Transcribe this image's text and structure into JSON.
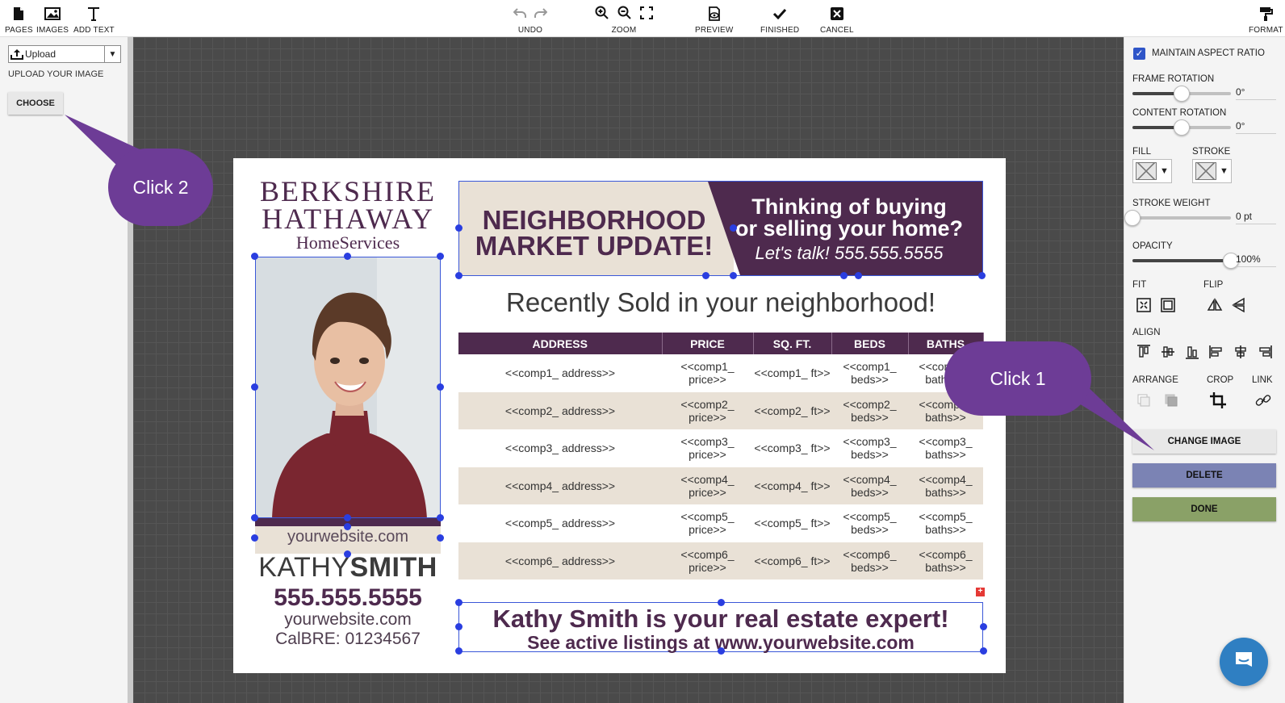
{
  "toolbar": {
    "pages": "PAGES",
    "images": "IMAGES",
    "add_text": "ADD TEXT",
    "undo": "UNDO",
    "zoom": "ZOOM",
    "preview": "PREVIEW",
    "finished": "FINISHED",
    "cancel": "CANCEL",
    "format": "FORMAT"
  },
  "left_panel": {
    "upload_select": "Upload",
    "upload_label": "UPLOAD YOUR IMAGE",
    "choose_button": "CHOOSE"
  },
  "card": {
    "logo_line1": "BERKSHIRE",
    "logo_line2": "HATHAWAY",
    "logo_line3": "HomeServices",
    "header_left": "NEIGHBORHOOD MARKET UPDATE!",
    "header_right_line1": "Thinking of buying",
    "header_right_line2": "or selling your home?",
    "header_right_line3": "Let's talk! 555.555.5555",
    "sold_title": "Recently Sold in your neighborhood!",
    "table": {
      "headers": [
        "ADDRESS",
        "PRICE",
        "SQ. FT.",
        "BEDS",
        "BATHS"
      ],
      "rows": [
        [
          "<<comp1_ address>>",
          "<<comp1_ price>>",
          "<<comp1_ ft>>",
          "<<comp1_ beds>>",
          "<<comp1_ baths>>"
        ],
        [
          "<<comp2_ address>>",
          "<<comp2_ price>>",
          "<<comp2_ ft>>",
          "<<comp2_ beds>>",
          "<<comp2_ baths>>"
        ],
        [
          "<<comp3_ address>>",
          "<<comp3_ price>>",
          "<<comp3_ ft>>",
          "<<comp3_ beds>>",
          "<<comp3_ baths>>"
        ],
        [
          "<<comp4_ address>>",
          "<<comp4_ price>>",
          "<<comp4_ ft>>",
          "<<comp4_ beds>>",
          "<<comp4_ baths>>"
        ],
        [
          "<<comp5_ address>>",
          "<<comp5_ price>>",
          "<<comp5_ ft>>",
          "<<comp5_ beds>>",
          "<<comp5_ baths>>"
        ],
        [
          "<<comp6_ address>>",
          "<<comp6_ price>>",
          "<<comp6_ ft>>",
          "<<comp6_ beds>>",
          "<<comp6_ baths>>"
        ]
      ]
    },
    "website_band": "yourwebsite.com",
    "agent_first": "KATHY",
    "agent_last": "SMITH",
    "agent_phone": "555.555.5555",
    "agent_website": "yourwebsite.com",
    "agent_license": "CalBRE: 01234567",
    "bottom_line1": "Kathy Smith is your real estate expert!",
    "bottom_line2": "See active listings at www.yourwebsite.com"
  },
  "right_panel": {
    "maintain_aspect": "MAINTAIN ASPECT RATIO",
    "maintain_aspect_checked": true,
    "frame_rotation_label": "FRAME ROTATION",
    "frame_rotation_value": "0°",
    "frame_rotation_level": 0.5,
    "content_rotation_label": "CONTENT ROTATION",
    "content_rotation_value": "0°",
    "content_rotation_level": 0.5,
    "fill_label": "FILL",
    "stroke_label": "STROKE",
    "stroke_weight_label": "STROKE WEIGHT",
    "stroke_weight_value": "0 pt",
    "stroke_weight_level": 0,
    "opacity_label": "OPACITY",
    "opacity_value": "100%",
    "opacity_level": 1,
    "fit_label": "FIT",
    "flip_label": "FLIP",
    "align_label": "ALIGN",
    "arrange_label": "ARRANGE",
    "crop_label": "CROP",
    "link_label": "LINK",
    "change_image": "CHANGE IMAGE",
    "delete": "DELETE",
    "done": "DONE"
  },
  "callouts": {
    "click1": "Click 1",
    "click2": "Click 2"
  },
  "colors": {
    "brand_purple": "#4e2a4e",
    "beige": "#e9e1d6",
    "callout_purple": "#6d3c96",
    "delete_button": "#7b83b4",
    "done_button": "#8aa167",
    "selection_blue": "#3a57d8"
  },
  "icons": [
    "pages-icon",
    "images-icon",
    "add-text-icon",
    "undo-icon",
    "redo-icon",
    "zoom-in-icon",
    "zoom-out-icon",
    "fullscreen-icon",
    "preview-icon",
    "finished-icon",
    "cancel-icon",
    "format-icon",
    "upload-icon",
    "chat-icon"
  ]
}
